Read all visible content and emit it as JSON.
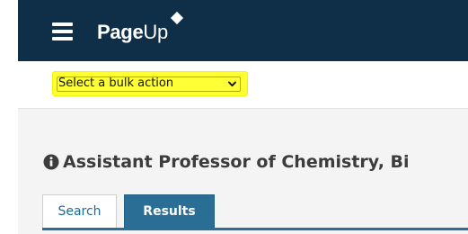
{
  "header": {
    "logo_part1": "Page",
    "logo_part2": "Up",
    "bg_color": "#0f2e48"
  },
  "toolbar": {
    "bulk_action": {
      "selected": "Select a bulk action",
      "highlight_color": "#ffff33"
    }
  },
  "main": {
    "title": "Assistant Professor of Chemistry, Bi",
    "tabs": [
      {
        "label": "Search",
        "active": false
      },
      {
        "label": "Results",
        "active": true
      }
    ],
    "accent_color": "#2a6e96"
  }
}
